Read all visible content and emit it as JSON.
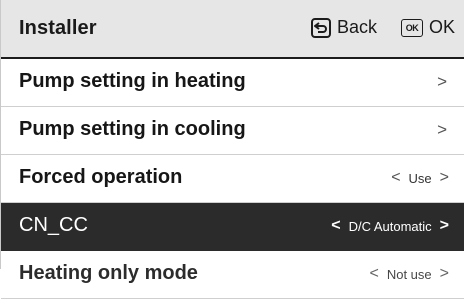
{
  "header": {
    "title": "Installer",
    "back_label": "Back",
    "ok_key_label": "OK",
    "ok_label": "OK"
  },
  "menu": {
    "items": [
      {
        "label": "Pump setting in heating",
        "control": "chevron-right"
      },
      {
        "label": "Pump setting in cooling",
        "control": "chevron-right"
      },
      {
        "label": "Forced operation",
        "control": "value-selector",
        "value": "Use"
      },
      {
        "label": "CN_CC",
        "control": "value-selector",
        "value": "D/C Automatic",
        "selected": true
      },
      {
        "label": "Heating only mode",
        "control": "value-selector",
        "value": "Not use"
      }
    ]
  },
  "colors": {
    "header_bg": "#e6e6e6",
    "selected_bg": "#2b2b2b",
    "text": "#1a1a1a"
  }
}
